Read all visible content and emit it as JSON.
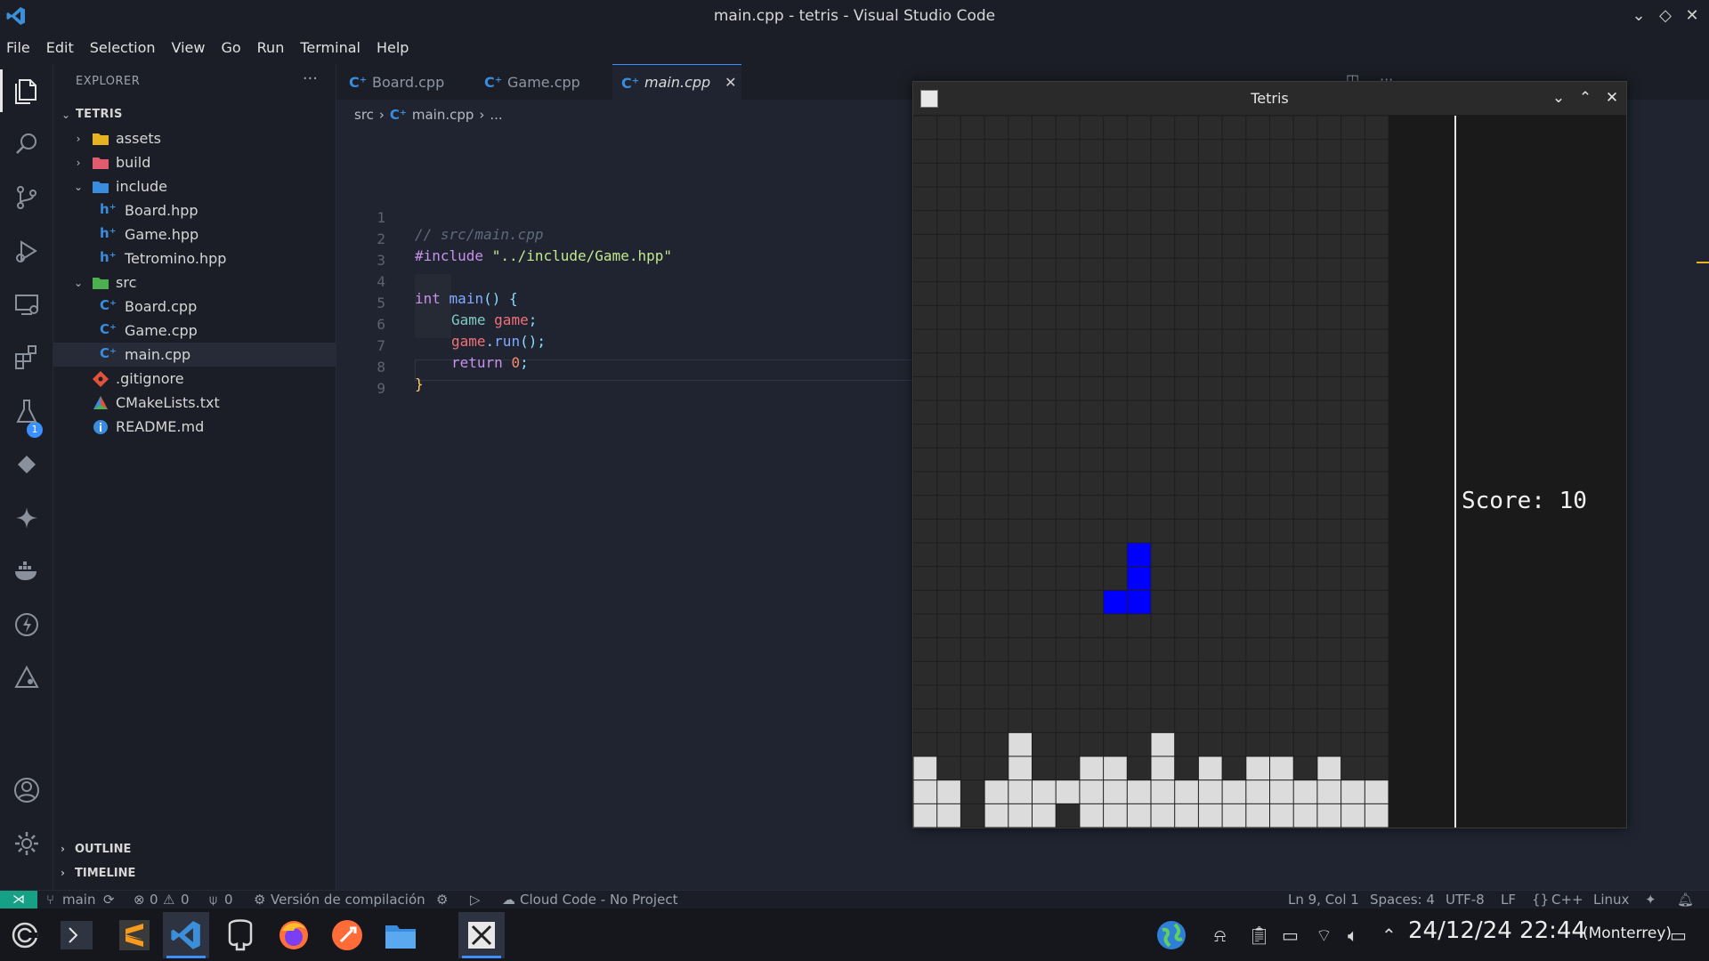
{
  "window": {
    "title": "main.cpp - tetris - Visual Studio Code"
  },
  "menu": [
    "File",
    "Edit",
    "Selection",
    "View",
    "Go",
    "Run",
    "Terminal",
    "Help"
  ],
  "activity": {
    "extensions_badge": "1"
  },
  "explorer": {
    "header": "EXPLORER",
    "project": "TETRIS",
    "items": [
      {
        "label": "assets",
        "kind": "folder",
        "color": "#e6b422"
      },
      {
        "label": "build",
        "kind": "folder",
        "color": "#e05c6e"
      },
      {
        "label": "include",
        "kind": "folder-open",
        "color": "#3a8dde"
      },
      {
        "label": "Board.hpp",
        "kind": "hpp"
      },
      {
        "label": "Game.hpp",
        "kind": "hpp"
      },
      {
        "label": "Tetromino.hpp",
        "kind": "hpp"
      },
      {
        "label": "src",
        "kind": "folder-open",
        "color": "#4caf50"
      },
      {
        "label": "Board.cpp",
        "kind": "cpp"
      },
      {
        "label": "Game.cpp",
        "kind": "cpp"
      },
      {
        "label": "main.cpp",
        "kind": "cpp"
      },
      {
        "label": ".gitignore",
        "kind": "git"
      },
      {
        "label": "CMakeLists.txt",
        "kind": "cmake"
      },
      {
        "label": "README.md",
        "kind": "info"
      }
    ],
    "outline": "OUTLINE",
    "timeline": "TIMELINE"
  },
  "tabs": [
    {
      "label": "Board.cpp"
    },
    {
      "label": "Game.cpp"
    },
    {
      "label": "main.cpp"
    }
  ],
  "breadcrumb": {
    "folder": "src",
    "file": "main.cpp",
    "rest": "..."
  },
  "code": {
    "line_numbers": [
      "1",
      "2",
      "3",
      "4",
      "5",
      "6",
      "7",
      "8",
      "9"
    ],
    "l1": "// src/main.cpp",
    "l2_directive": "#include",
    "l2_path": "\"../include/Game.hpp\"",
    "l4_kw": "int",
    "l4_fn": "main",
    "l4_rest": "() {",
    "l5_type": "Game",
    "l5_var": "game",
    "l5_end": ";",
    "l6_var": "game",
    "l6_dot": ".",
    "l6_fn": "run",
    "l6_end": "();",
    "l7_kw": "return",
    "l7_num": "0",
    "l7_end": ";",
    "l8": "}"
  },
  "tetris": {
    "title": "Tetris",
    "score_text": "Score: 10",
    "board": {
      "cols": 20,
      "rows": 30,
      "empty_color": "#2b2b2b",
      "filled_color": "#dcdcdc",
      "active_color": "#0000ff",
      "active_piece": [
        [
          9,
          18
        ],
        [
          9,
          19
        ],
        [
          9,
          20
        ],
        [
          8,
          20
        ]
      ],
      "settled_rows": {
        "26": [
          4,
          10
        ],
        "27": [
          0,
          4,
          7,
          8,
          10,
          12,
          14,
          15,
          17
        ],
        "28": [
          0,
          1,
          3,
          4,
          5,
          6,
          7,
          8,
          9,
          10,
          11,
          12,
          13,
          14,
          15,
          16,
          17,
          18,
          19
        ],
        "29": [
          0,
          1,
          3,
          4,
          5,
          7,
          8,
          9,
          10,
          11,
          12,
          13,
          14,
          15,
          16,
          17,
          18,
          19
        ]
      }
    }
  },
  "status": {
    "branch": "main",
    "errors": "0",
    "warnings": "0",
    "ports": "0",
    "build": "Versión de compilación",
    "cloud": "Cloud Code - No Project",
    "cursor": "Ln 9, Col 1",
    "spaces": "Spaces: 4",
    "encoding": "UTF-8",
    "eol": "LF",
    "language": "C++",
    "os": "Linux"
  },
  "taskbar": {
    "clock": "24/12/24 22:44",
    "timezone": "(Monterrey)"
  },
  "colors": {
    "accent": "#3a90ff",
    "remote": "#16a085"
  }
}
